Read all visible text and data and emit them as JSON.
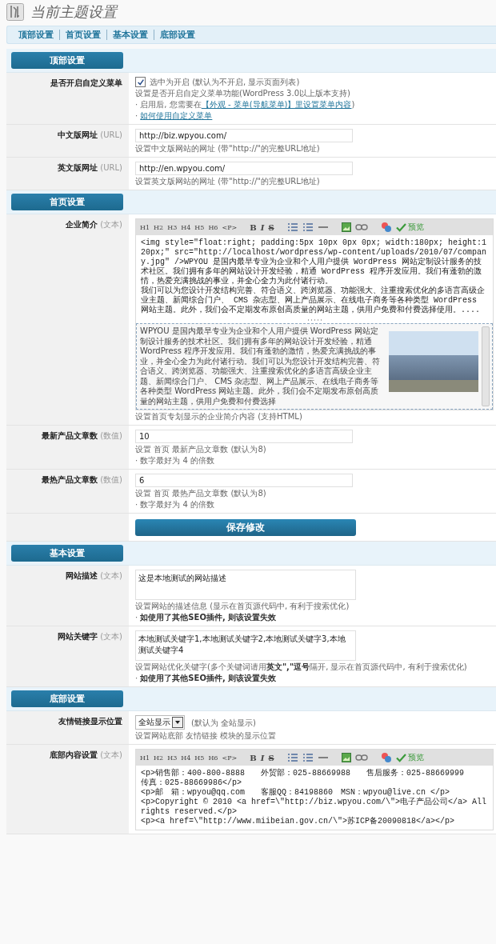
{
  "header": {
    "title": "当前主题设置"
  },
  "nav": [
    {
      "label": "顶部设置"
    },
    {
      "label": "首页设置"
    },
    {
      "label": "基本设置"
    },
    {
      "label": "底部设置"
    }
  ],
  "sections": [
    {
      "title": "顶部设置",
      "rows": [
        {
          "kind": "checkbox",
          "label": "是否开启自定义菜单",
          "checked": true,
          "checkbox_label": "选中为开启 (默认为不开启, 显示页面列表)",
          "notes": [
            {
              "text": "设置是否开启自定义菜单功能(WordPress 3.0以上版本支持)"
            },
            {
              "text": "· 启用后, 您需要在",
              "link": "【外观 - 菜单(导航菜单)】里设置菜单内容",
              "after": ")"
            },
            {
              "text": "· ",
              "link": "如何使用自定义菜单"
            }
          ]
        },
        {
          "kind": "input",
          "label": "中文版网址",
          "type": "(URL)",
          "value": "http://biz.wpyou.com/",
          "notes": [
            {
              "text": "设置中文版网站的网址 (带\"http://\"的完整URL地址)"
            }
          ]
        },
        {
          "kind": "input",
          "label": "英文版网址",
          "type": "(URL)",
          "value": "http://en.wpyou.com/",
          "notes": [
            {
              "text": "设置英文版网站的网址 (带\"http://\"的完整URL地址)"
            }
          ]
        }
      ]
    },
    {
      "title": "首页设置",
      "rows": [
        {
          "kind": "editor",
          "label": "企业简介",
          "type": "(文本)",
          "toolbar": {
            "headings": [
              "H1",
              "H2",
              "H3",
              "H4",
              "H5",
              "H6",
              "<P>"
            ],
            "format": [
              "B",
              "I",
              "S"
            ],
            "preview": "预览"
          },
          "source": [
            "<img style=\"float:right; padding:5px 10px 0px 0px; width:180px; height:120px;\" src=\"http://localhost/wordpress/wp-content/uploads/2010/07/company.jpg\" />WPYOU 是国内最早专业为企业和个人用户提供 WordPress 网站定制设计服务的技术社区。我们拥有多年的网站设计开发经验，精通 WordPress 程序开发应用。我们有蓬勃的激情，热爱充满挑战的事业，并全心全力为此付诸行动。",
            "我们可以为您设计开发结构完善、符合语义、跨浏览器、功能强大、注重搜索优化的多语言高级企业主题、新闻综合门户、 CMS 杂志型、网上产品展示、在线电子商务等各种类型 WordPress 网站主题。此外，我们会不定期发布原创高质量的网站主题，供用户免费和付费选择使用。...."
          ],
          "preview": {
            "text": "WPYOU 是国内最早专业为企业和个人用户提供 WordPress 网站定制设计服务的技术社区。我们拥有多年的网站设计开发经验，精通 WordPress 程序开发应用。我们有蓬勃的激情，热爱充满挑战的事业，并全心全力为此付诸行动。我们可以为您设计开发结构完善、符合语义、跨浏览器、功能强大、注重搜索优化的多语言高级企业主题、新闻综合门户、 CMS 杂志型、网上产品展示、在线电子商务等各种类型 WordPress 网站主题。此外，我们会不定期发布原创高质量的网站主题，供用户免费和付费选择"
          },
          "notes": [
            {
              "text": "设置首页专划显示的企业简介内容 (支持HTML)"
            }
          ]
        },
        {
          "kind": "input",
          "label": "最新产品文章数",
          "type": "(数值)",
          "value": "10",
          "notes": [
            {
              "text": "设置 首页 最新产品文章数 (默认为8)"
            },
            {
              "text": "· 数字最好为 4 的倍数"
            }
          ]
        },
        {
          "kind": "input",
          "label": "最热产品文章数",
          "type": "(数值)",
          "value": "6",
          "notes": [
            {
              "text": "设置 首页 最热产品文章数 (默认为8)"
            },
            {
              "text": "· 数字最好为 4 的倍数"
            }
          ]
        },
        {
          "kind": "save",
          "button": "保存修改"
        }
      ]
    },
    {
      "title": "基本设置",
      "rows": [
        {
          "kind": "textarea",
          "label": "网站描述",
          "type": "(文本)",
          "value": "这是本地测试的网站描述",
          "notes": [
            {
              "text": "设置网站的描述信息 (显示在首页源代码中, 有利于搜索优化)"
            },
            {
              "text": "· **如使用了其他SEO插件, 则该设置失效**"
            }
          ]
        },
        {
          "kind": "textarea",
          "label": "网站关键字",
          "type": "(文本)",
          "value": "本地测试关键字1,本地测试关键字2,本地测试关键字3,本地测试关键字4",
          "notes": [
            {
              "text": "设置网站优化关键字(多个关键词请用**英文\",\"逗号**隔开, 显示在首页源代码中, 有利于搜索优化)"
            },
            {
              "text": "· **如使用了其他SEO插件, 则该设置失效**"
            }
          ]
        }
      ]
    },
    {
      "title": "底部设置",
      "rows": [
        {
          "kind": "select",
          "label": "友情链接显示位置",
          "value": "全站显示",
          "default_note": "(默认为 全站显示)",
          "notes": [
            {
              "text": "设置网站底部 友情链接 模块的显示位置"
            }
          ]
        },
        {
          "kind": "editor",
          "label": "底部内容设置",
          "type": "(文本)",
          "toolbar": {
            "headings": [
              "H1",
              "H2",
              "H3",
              "H4",
              "H5",
              "H6",
              "<P>"
            ],
            "format": [
              "B",
              "I",
              "S"
            ],
            "preview": "预览"
          },
          "source": [
            "<p>销售部：400-800-8888　　外贸部：025-88669988　　售后服务：025-88669999　　传真：025-88669986</p>",
            "<p>邮　箱：wpyou@qq.com　　客服QQ：84198860　MSN：wpyou@live.cn </p>",
            "<p>Copyright © 2010 <a href=\\\"http://biz.wpyou.com/\\\">电子产品公司</a> All rights reserved.</p>",
            "<p><a href=\\\"http://www.miibeian.gov.cn/\\\">苏ICP备20090818</a></p>"
          ],
          "notes": []
        }
      ]
    }
  ]
}
